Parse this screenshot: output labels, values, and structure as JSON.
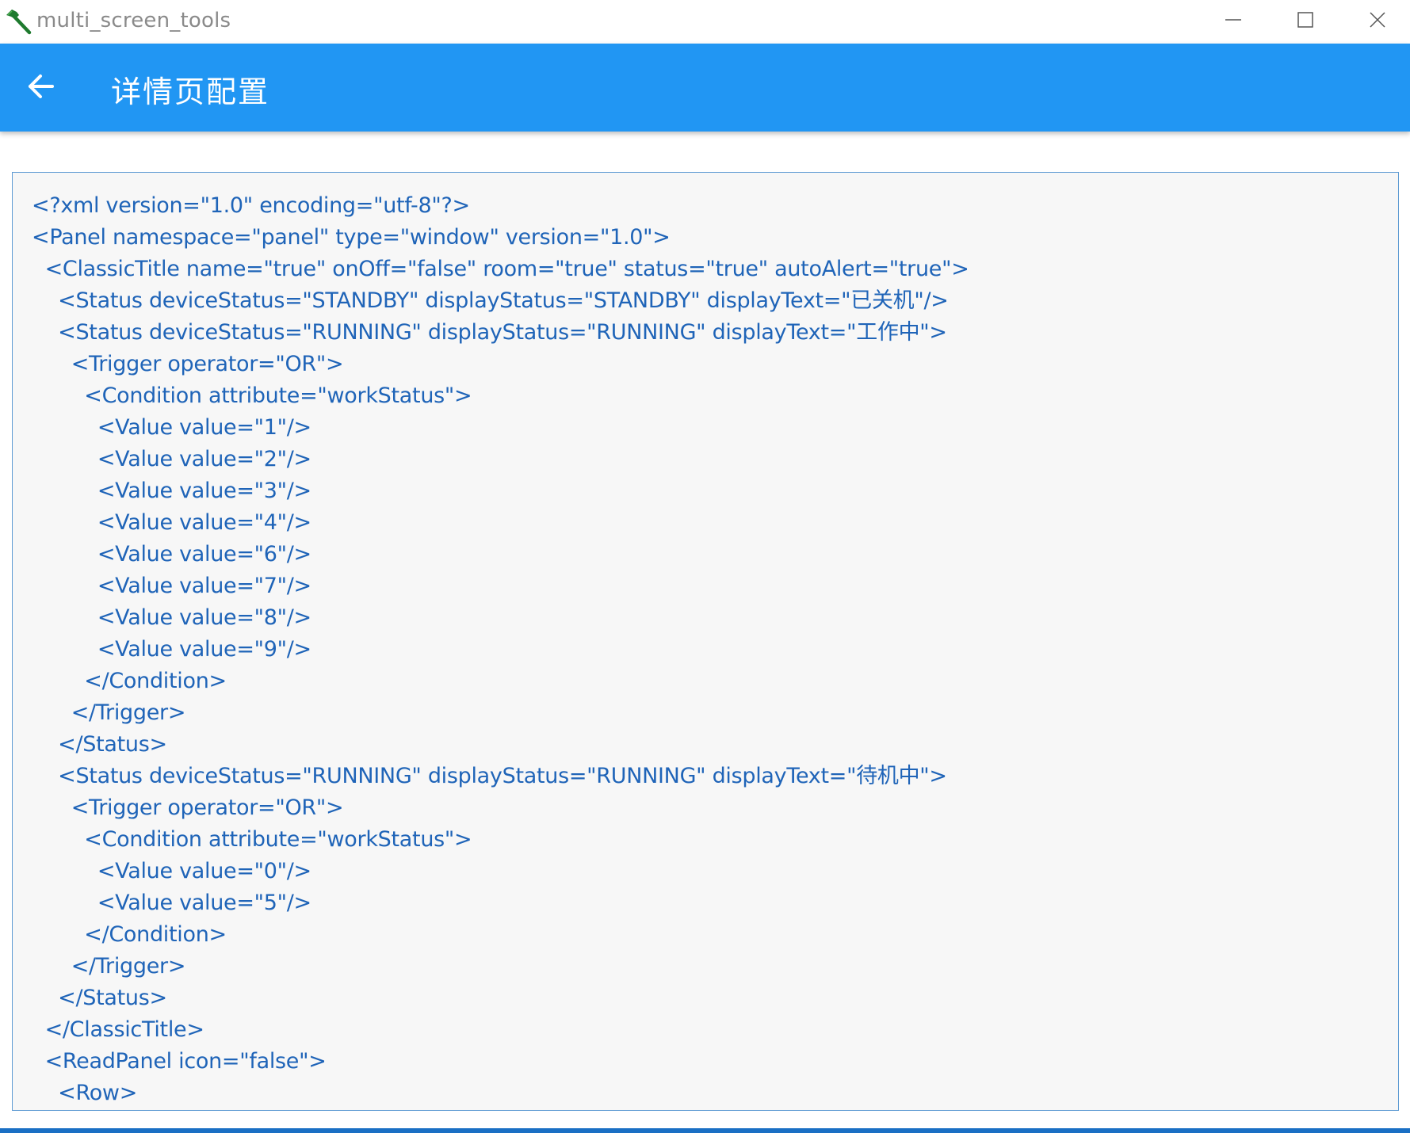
{
  "window": {
    "title": "multi_screen_tools",
    "controls": {
      "minimize": "minimize-icon",
      "maximize": "maximize-icon",
      "close": "close-icon"
    }
  },
  "appbar": {
    "back_icon": "arrow-left-icon",
    "title": "详情页配置",
    "color": "#2196f3"
  },
  "editor": {
    "text_color": "#1f64b8",
    "border_color": "#5f9bd3",
    "lines": [
      "<?xml version=\"1.0\" encoding=\"utf-8\"?>",
      "<Panel namespace=\"panel\" type=\"window\" version=\"1.0\">",
      "  <ClassicTitle name=\"true\" onOff=\"false\" room=\"true\" status=\"true\" autoAlert=\"true\">",
      "    <Status deviceStatus=\"STANDBY\" displayStatus=\"STANDBY\" displayText=\"已关机\"/>",
      "    <Status deviceStatus=\"RUNNING\" displayStatus=\"RUNNING\" displayText=\"工作中\">",
      "      <Trigger operator=\"OR\">",
      "        <Condition attribute=\"workStatus\">",
      "          <Value value=\"1\"/>",
      "          <Value value=\"2\"/>",
      "          <Value value=\"3\"/>",
      "          <Value value=\"4\"/>",
      "          <Value value=\"6\"/>",
      "          <Value value=\"7\"/>",
      "          <Value value=\"8\"/>",
      "          <Value value=\"9\"/>",
      "        </Condition>",
      "      </Trigger>",
      "    </Status>",
      "    <Status deviceStatus=\"RUNNING\" displayStatus=\"RUNNING\" displayText=\"待机中\">",
      "      <Trigger operator=\"OR\">",
      "        <Condition attribute=\"workStatus\">",
      "          <Value value=\"0\"/>",
      "          <Value value=\"5\"/>",
      "        </Condition>",
      "      </Trigger>",
      "    </Status>",
      "  </ClassicTitle>",
      "  <ReadPanel icon=\"false\">",
      "    <Row>"
    ]
  }
}
